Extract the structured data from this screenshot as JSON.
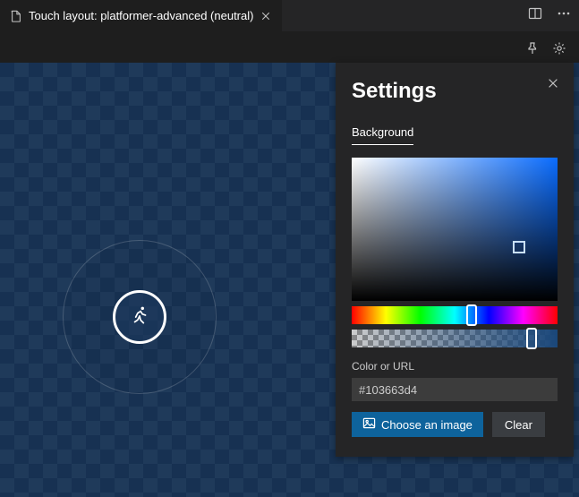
{
  "tab": {
    "label": "Touch layout: platformer-advanced (neutral)"
  },
  "settings_panel": {
    "title": "Settings",
    "section_tab": "Background",
    "color_label": "Color or URL",
    "color_value": "#103663d4",
    "choose_image_label": "Choose an image",
    "clear_label": "Clear"
  }
}
